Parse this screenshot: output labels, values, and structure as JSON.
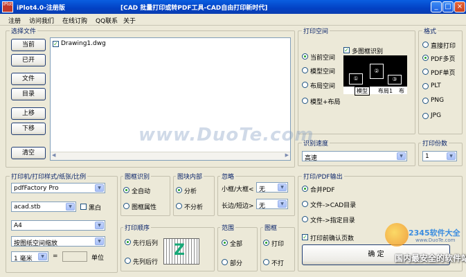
{
  "window": {
    "icon_text": "iPlot",
    "title": "iPlot4.0-注册版",
    "subtitle": "[CAD 批量打印或转PDF工具-CAD自由打印新时代]",
    "min": "_",
    "max": "□",
    "close": "×"
  },
  "menu": [
    "注册",
    "访问我们",
    "在线订购",
    "QQ联系",
    "关于"
  ],
  "files": {
    "label": "选择文件",
    "buttons": [
      "当前",
      "已开",
      "文件",
      "目录",
      "上移",
      "下移",
      "清空"
    ],
    "items": [
      {
        "name": "Drawing1.dwg",
        "checked": true
      }
    ]
  },
  "print_space": {
    "label": "打印空间",
    "options": [
      "当前空间",
      "模型空间",
      "布局空间",
      "模型+布局"
    ],
    "selected": "当前空间",
    "frame_detect": "多图框识别",
    "frame_detect_checked": true,
    "preview_numbers": [
      "①",
      "②",
      "③"
    ],
    "preview_tabs": [
      "模型",
      "布局1",
      "布"
    ]
  },
  "format": {
    "label": "格式",
    "options": [
      "直接打印",
      "PDF多页",
      "PDF单页",
      "PLT",
      "PNG",
      "JPG"
    ],
    "selected": "PDF多页"
  },
  "speed": {
    "label": "识别速度",
    "value": "高速"
  },
  "copies": {
    "label": "打印份数",
    "value": "1"
  },
  "printer": {
    "label": "打印机/打印样式/纸张/比例",
    "printer": "pdfFactory Pro",
    "style": "acad.stb",
    "bw_label": "黑白",
    "paper": "A4",
    "scale": "按图纸空间缩放",
    "unit_value": "1 毫米",
    "equals": "=",
    "unit_label": "单位"
  },
  "frame_recog": {
    "label": "图框识别",
    "options": [
      "全自动",
      "图框属性"
    ],
    "selected": "全自动"
  },
  "block_inner": {
    "label": "图块内部",
    "options": [
      "分析",
      "不分析"
    ],
    "selected": "分析"
  },
  "ignore": {
    "label": "忽略",
    "rows": [
      {
        "label": "小框/大框<",
        "value": "无"
      },
      {
        "label": "长边/短边>",
        "value": "无"
      }
    ]
  },
  "print_order": {
    "label": "打印顺序",
    "options": [
      "先行后列",
      "先列后行"
    ],
    "selected": "先行后列",
    "diagram_letter": "Z"
  },
  "range": {
    "label": "范围",
    "options": [
      "全部",
      "部分"
    ],
    "selected": "全部"
  },
  "frame": {
    "label": "图框",
    "options": [
      "打印",
      "不打"
    ],
    "selected": "打印"
  },
  "pdf_output": {
    "label": "打印/PDF输出",
    "options": [
      "合并PDF",
      "文件->CAD目录",
      "文件->指定目录"
    ],
    "selected": "合并PDF",
    "confirm_label": "打印前确认页数",
    "confirm_checked": true,
    "ok_button": "确 定"
  },
  "watermarks": {
    "duote": "www.DuoTe.com",
    "logo_2345": "2345软件大全",
    "url_2345": "www.DuoTe.com",
    "slogan": "国内最安全的软件站"
  },
  "colors": {
    "titlebar": "#0241c4",
    "group_label": "#0a246a",
    "radio_dot": "#21a121",
    "face": "#ece9d8"
  }
}
